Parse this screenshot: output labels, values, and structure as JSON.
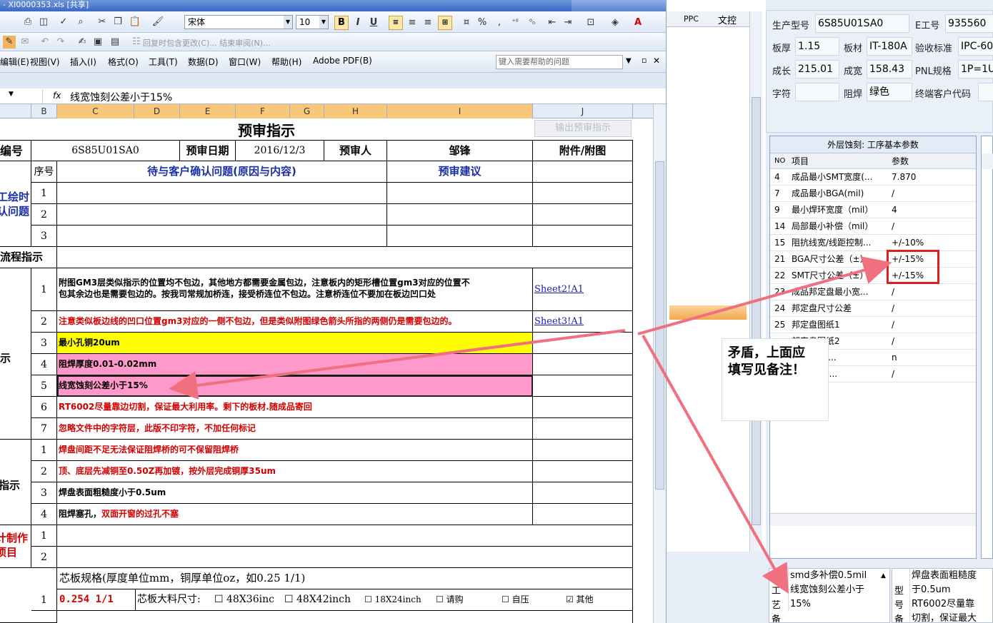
{
  "window_title": "- XI0000353.xls [共享]",
  "toolbar": {
    "font_name": "宋体",
    "font_size": "10",
    "bold": "B",
    "italic": "I",
    "underline": "U",
    "percent": "%",
    "comma": ",",
    "tracking_text": "回复时包含更改(C)... 结束审阅(N)..."
  },
  "menu": [
    "编辑(E)",
    "视图(V)",
    "插入(I)",
    "格式(O)",
    "工具(T)",
    "数据(D)",
    "窗口(W)",
    "帮助(H)",
    "Adobe PDF(B)"
  ],
  "help_placeholder": "键入需要帮助的问题",
  "formula_bar": {
    "fx": "fx",
    "content": "线宽蚀刻公差小于15%"
  },
  "columns": [
    "B",
    "C",
    "D",
    "E",
    "F",
    "G",
    "H",
    "I",
    "J"
  ],
  "sheet": {
    "title": "预审指示",
    "export_button": "输出预审指示",
    "header_row": {
      "label": "编号",
      "code": "6S85U01SA0",
      "date_label": "预审日期",
      "date": "2016/12/3",
      "reviewer_label": "预审人",
      "reviewer": "邹锋",
      "attach_label": "附件/附图"
    },
    "sub_header": {
      "seq": "序号",
      "question": "待与客户确认问题(原因与内容)",
      "suggest": "预审建议"
    },
    "section_a": "工绘时\n认问题",
    "section_a_l1": "工绘时",
    "section_a_l2": "认问题",
    "flow_label": "流程指示",
    "nums": [
      "1",
      "2",
      "3",
      "4",
      "5",
      "6",
      "7"
    ],
    "flow_rows": [
      {
        "text1": "附图GM3层类似指示的位置均不包边，其他地方都需要金属包边，注意板内的矩形槽位置gm3对应的位置不",
        "text2": "包其余边也是需要包边的。按我司常规加桥连，接受桥连位不包边。注意桥连位不要加在板边凹口处",
        "link": "Sheet2!A1"
      },
      {
        "text": "注意类似板边线的凹口位置gm3对应的一侧不包边，但是类似附图绿色箭头所指的两侧仍是需要包边的。",
        "link": "Sheet3!A1"
      },
      {
        "text": "最小孔铜20um"
      },
      {
        "text": "阻焊厚度0.01-0.02mm"
      },
      {
        "text": "线宽蚀刻公差小于15%"
      },
      {
        "text": "RT6002尽量靠边切割，保证最大利用率。剩下的板材.随成品寄回"
      },
      {
        "text": "忽略文件中的字符层，此版不印字符，不加任何标记"
      }
    ],
    "section_b": "示",
    "section_c": "指示",
    "section_c_rows": [
      {
        "text": "焊盘间距不足无法保证阻焊桥的可不保留阻焊桥"
      },
      {
        "text": "顶、底层先减铜至0.50Z再加镀，按外层完成铜厚35um"
      },
      {
        "text": "焊盘表面粗糙度小于0.5um"
      },
      {
        "pre": "阻焊塞孔，",
        "post": "双面开窗的过孔不塞"
      }
    ],
    "section_d_l1": "计制作",
    "section_d_l2": "项目",
    "core_spec": "芯板规格(厚度单位mm，铜厚单位oz，如0.25 1/1)",
    "core_rows": [
      {
        "num": "1",
        "spec": "0.254 1/1",
        "size_label": "芯板大料尺寸:",
        "opts": [
          "48X36inc",
          "48X42inch",
          "18X24inch",
          "请购",
          "自压",
          "其他"
        ]
      }
    ]
  },
  "mid_panel": {
    "tab1": "PPC",
    "tab2": "文控"
  },
  "right_panel": {
    "fields": [
      {
        "label": "生产型号",
        "value": "6S85U01SA0"
      },
      {
        "label": "E工号",
        "value": "935560"
      },
      {
        "label": "板厚",
        "value": "1.15"
      },
      {
        "label": "板材",
        "value": "IT-180A"
      },
      {
        "label": "验收标准",
        "value": "IPC-60"
      },
      {
        "label": "成长",
        "value": "215.01"
      },
      {
        "label": "成宽",
        "value": "158.43"
      },
      {
        "label": "PNL规格",
        "value": "1P=1U"
      },
      {
        "label": "字符",
        "value": ""
      },
      {
        "label": "阻焊",
        "value": "绿色"
      },
      {
        "label": "终端客户代码",
        "value": ""
      }
    ],
    "grid_title": "外层蚀刻: 工序基本参数",
    "grid_headers": [
      "NO",
      "项目",
      "参数"
    ],
    "grid_rows": [
      {
        "no": "4",
        "item": "成品最小SMT宽度(...",
        "param": "7.870"
      },
      {
        "no": "7",
        "item": "成品最小BGA(mil)",
        "param": "/"
      },
      {
        "no": "9",
        "item": "最小焊环宽度（mil）",
        "param": "4"
      },
      {
        "no": "14",
        "item": "局部最小补偿（mil）",
        "param": "/"
      },
      {
        "no": "15",
        "item": "阻抗线宽/线距控制...",
        "param": "+/-10%"
      },
      {
        "no": "21",
        "item": "BGA尺寸公差（±）",
        "param": "+/-15%"
      },
      {
        "no": "22",
        "item": "SMT尺寸公差（±）",
        "param": "+/-15%"
      },
      {
        "no": "23",
        "item": "成品邦定盘最小宽...",
        "param": "/"
      },
      {
        "no": "24",
        "item": "邦定盘尺寸公差",
        "param": "/"
      },
      {
        "no": "25",
        "item": "邦定盘图纸1",
        "param": "/"
      },
      {
        "no": "",
        "item": "邦定盘图纸2",
        "param": "/"
      },
      {
        "no": "",
        "item": "非正负10...",
        "param": "n"
      },
      {
        "no": "",
        "item": "削)补偿后...",
        "param": "/"
      }
    ],
    "bottom_left_labels": [
      "工",
      "艺",
      "备"
    ],
    "bottom_left_text": [
      "smd多补偿0.5mil",
      "线宽蚀刻公差小于",
      "15%"
    ],
    "bottom_right_labels": [
      "型",
      "号",
      "备"
    ],
    "bottom_right_text": [
      "焊盘表面粗糙度",
      "于0.5um",
      "RT6002尽量靠",
      "切割，保证最大"
    ]
  },
  "annotation": {
    "line1": "矛盾，上面应",
    "line2": "填写见备注！"
  },
  "colors": {
    "highlight_yellow": "#ffff00",
    "highlight_pink": "#ff99cc",
    "arrow": "#f07080",
    "box": "#e02020"
  }
}
